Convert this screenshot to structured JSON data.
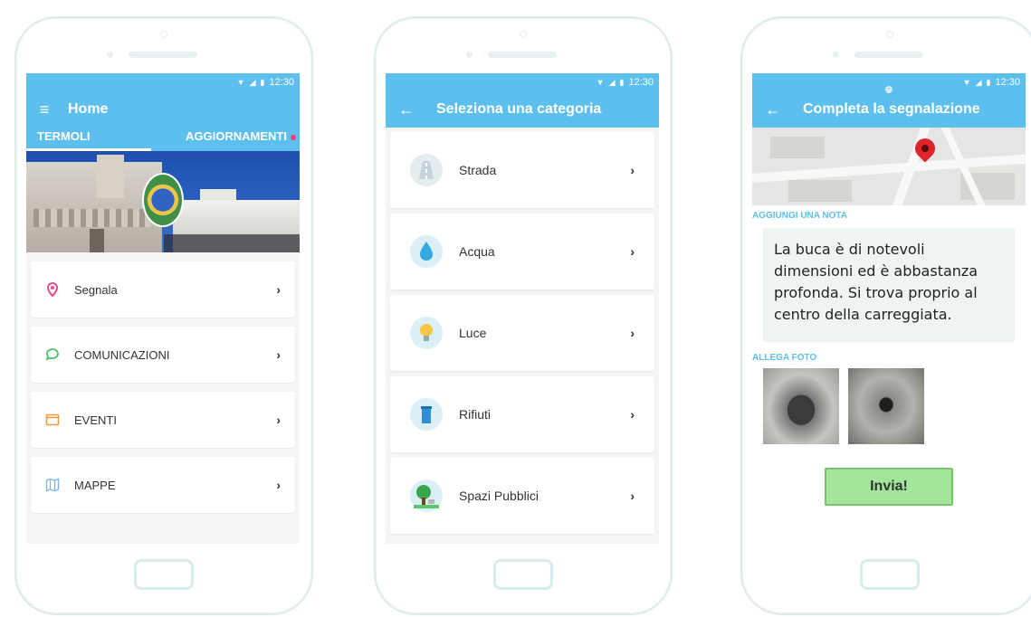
{
  "status_bar": {
    "time": "12:30"
  },
  "phone1": {
    "title": "Home",
    "tabs": [
      {
        "label": "TERMOLI",
        "active": true
      },
      {
        "label": "AGGIORNAMENTI",
        "active": false,
        "badge": true
      }
    ],
    "menu": [
      {
        "label": "Segnala",
        "icon": "location-pin-icon",
        "color": "#e94b8f"
      },
      {
        "label": "COMUNICAZIONI",
        "icon": "chat-bubble-icon",
        "color": "#4cc36b"
      },
      {
        "label": "EVENTI",
        "icon": "calendar-icon",
        "color": "#f29b3a"
      },
      {
        "label": "MAPPE",
        "icon": "map-icon",
        "color": "#7fb6e6"
      }
    ]
  },
  "phone2": {
    "title": "Seleziona una categoria",
    "categories": [
      {
        "label": "Strada",
        "icon": "road-icon"
      },
      {
        "label": "Acqua",
        "icon": "water-drop-icon"
      },
      {
        "label": "Luce",
        "icon": "light-bulb-icon"
      },
      {
        "label": "Rifiuti",
        "icon": "trash-bin-icon"
      },
      {
        "label": "Spazi Pubblici",
        "icon": "tree-icon"
      }
    ]
  },
  "phone3": {
    "title": "Completa la segnalazione",
    "note_label": "AGGIUNGI UNA NOTA",
    "note_text": "La buca è di notevoli dimensioni ed è abbastanza profonda. Si trova proprio al centro della carreggiata.",
    "photos_label": "ALLEGA FOTO",
    "submit_label": "Invia!"
  },
  "colors": {
    "accent": "#5dbfee",
    "badge": "#ef4068",
    "submit": "#a2e59b",
    "background": "#f4f6f6"
  }
}
